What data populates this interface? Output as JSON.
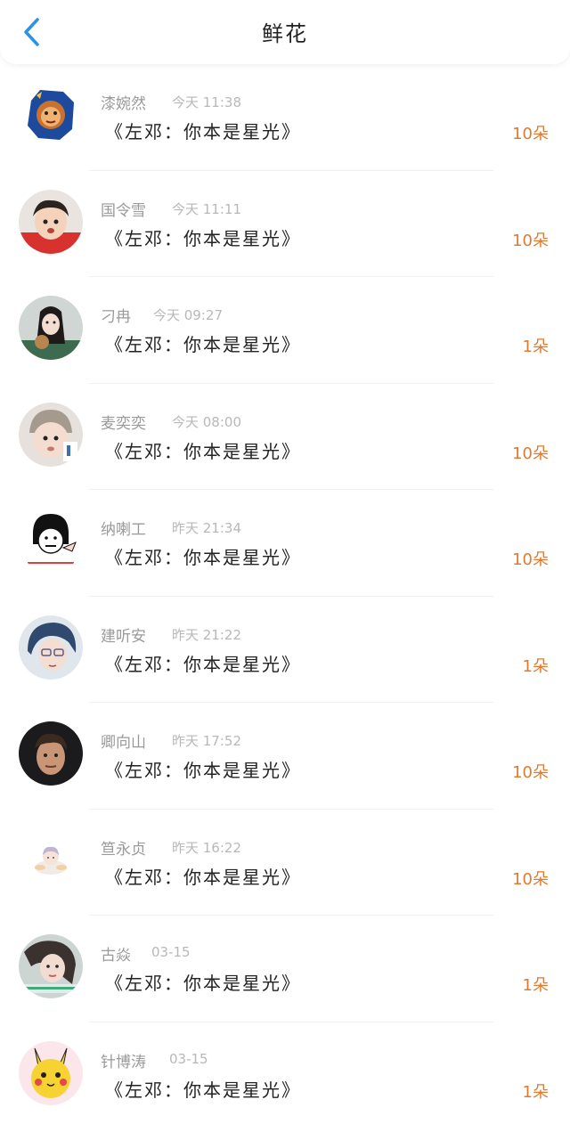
{
  "header": {
    "title": "鲜花",
    "accent": "#2a93e6"
  },
  "records": [
    {
      "name": "漆婉然",
      "time": "今天 11:38",
      "content": "《左邓：你本是星光》",
      "count": "10朵",
      "avatar": "cartoon-bear-avatar"
    },
    {
      "name": "国令雪",
      "time": "今天 11:11",
      "content": "《左邓：你本是星光》",
      "count": "10朵",
      "avatar": "child-avatar"
    },
    {
      "name": "刁冉",
      "time": "今天 09:27",
      "content": "《左邓：你本是星光》",
      "count": "1朵",
      "avatar": "girl-avatar"
    },
    {
      "name": "麦奕奕",
      "time": "今天 08:00",
      "content": "《左邓：你本是星光》",
      "count": "10朵",
      "avatar": "baby-avatar"
    },
    {
      "name": "纳喇工",
      "time": "昨天 21:34",
      "content": "《左邓：你本是星光》",
      "count": "10朵",
      "avatar": "meme-avatar"
    },
    {
      "name": "建听安",
      "time": "昨天 21:22",
      "content": "《左邓：你本是星光》",
      "count": "1朵",
      "avatar": "anime-boy-avatar"
    },
    {
      "name": "卿向山",
      "time": "昨天 17:52",
      "content": "《左邓：你本是星光》",
      "count": "10朵",
      "avatar": "man-avatar"
    },
    {
      "name": "笪永贞",
      "time": "昨天 16:22",
      "content": "《左邓：你本是星光》",
      "count": "10朵",
      "avatar": "chibi-avatar"
    },
    {
      "name": "古焱",
      "time": "03-15",
      "content": "《左邓：你本是星光》",
      "count": "1朵",
      "avatar": "woman-avatar"
    },
    {
      "name": "针博涛",
      "time": "03-15",
      "content": "《左邓：你本是星光》",
      "count": "1朵",
      "avatar": "pikachu-avatar"
    }
  ],
  "colors": {
    "count": "#e07a2e",
    "name": "#9a9a9a",
    "time": "#b8b8b8"
  }
}
